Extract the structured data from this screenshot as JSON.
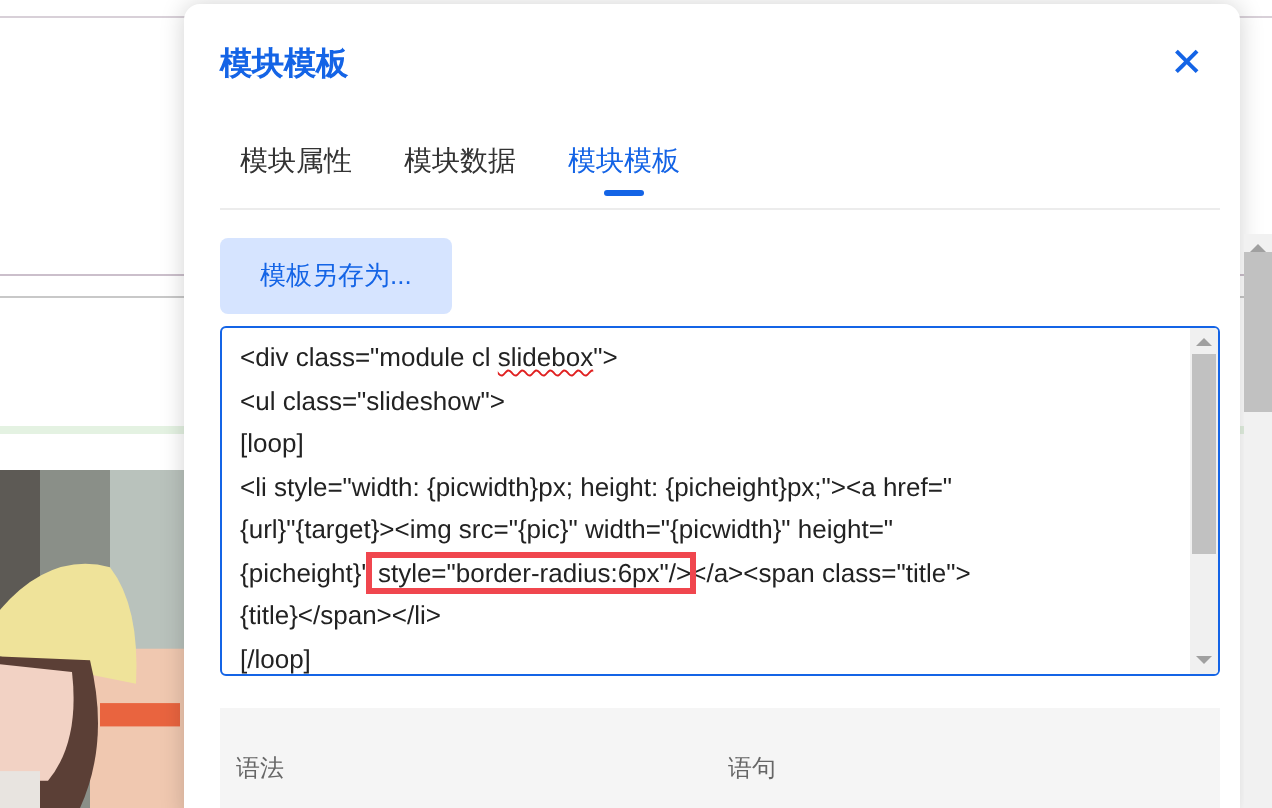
{
  "dialog": {
    "title": "模块模板",
    "close_icon": "✕"
  },
  "tabs": [
    {
      "label": "模块属性",
      "selected": false
    },
    {
      "label": "模块数据",
      "selected": false
    },
    {
      "label": "模块模板",
      "selected": true
    }
  ],
  "save_as_button": "模板另存为...",
  "code_lines": [
    [
      {
        "kind": "plain",
        "text": "<div class=\"module cl "
      },
      {
        "kind": "misspelled",
        "text": "slidebox"
      },
      {
        "kind": "plain",
        "text": "\">"
      }
    ],
    [
      {
        "kind": "plain",
        "text": "<ul class=\"slideshow\">"
      }
    ],
    [
      {
        "kind": "plain",
        "text": "[loop]"
      }
    ],
    [
      {
        "kind": "plain",
        "text": "<li style=\"width: {picwidth}px; height: {picheight}px;\"><a href=\""
      }
    ],
    [
      {
        "kind": "plain",
        "text": "{url}\"{target}><img src=\"{pic}\" width=\"{picwidth}\" height=\""
      }
    ],
    [
      {
        "kind": "plain",
        "text": "{picheight}\""
      },
      {
        "kind": "highlight",
        "text": " style=\"border-radius:6px\"/>"
      },
      {
        "kind": "plain",
        "text": "</a><span class=\"title\">"
      }
    ],
    [
      {
        "kind": "plain",
        "text": "{title}</span></li>"
      }
    ],
    [
      {
        "kind": "plain",
        "text": "[/loop]"
      }
    ]
  ],
  "table": {
    "columns": [
      "语法",
      "语句"
    ]
  },
  "background": {
    "kind": "picture"
  }
}
